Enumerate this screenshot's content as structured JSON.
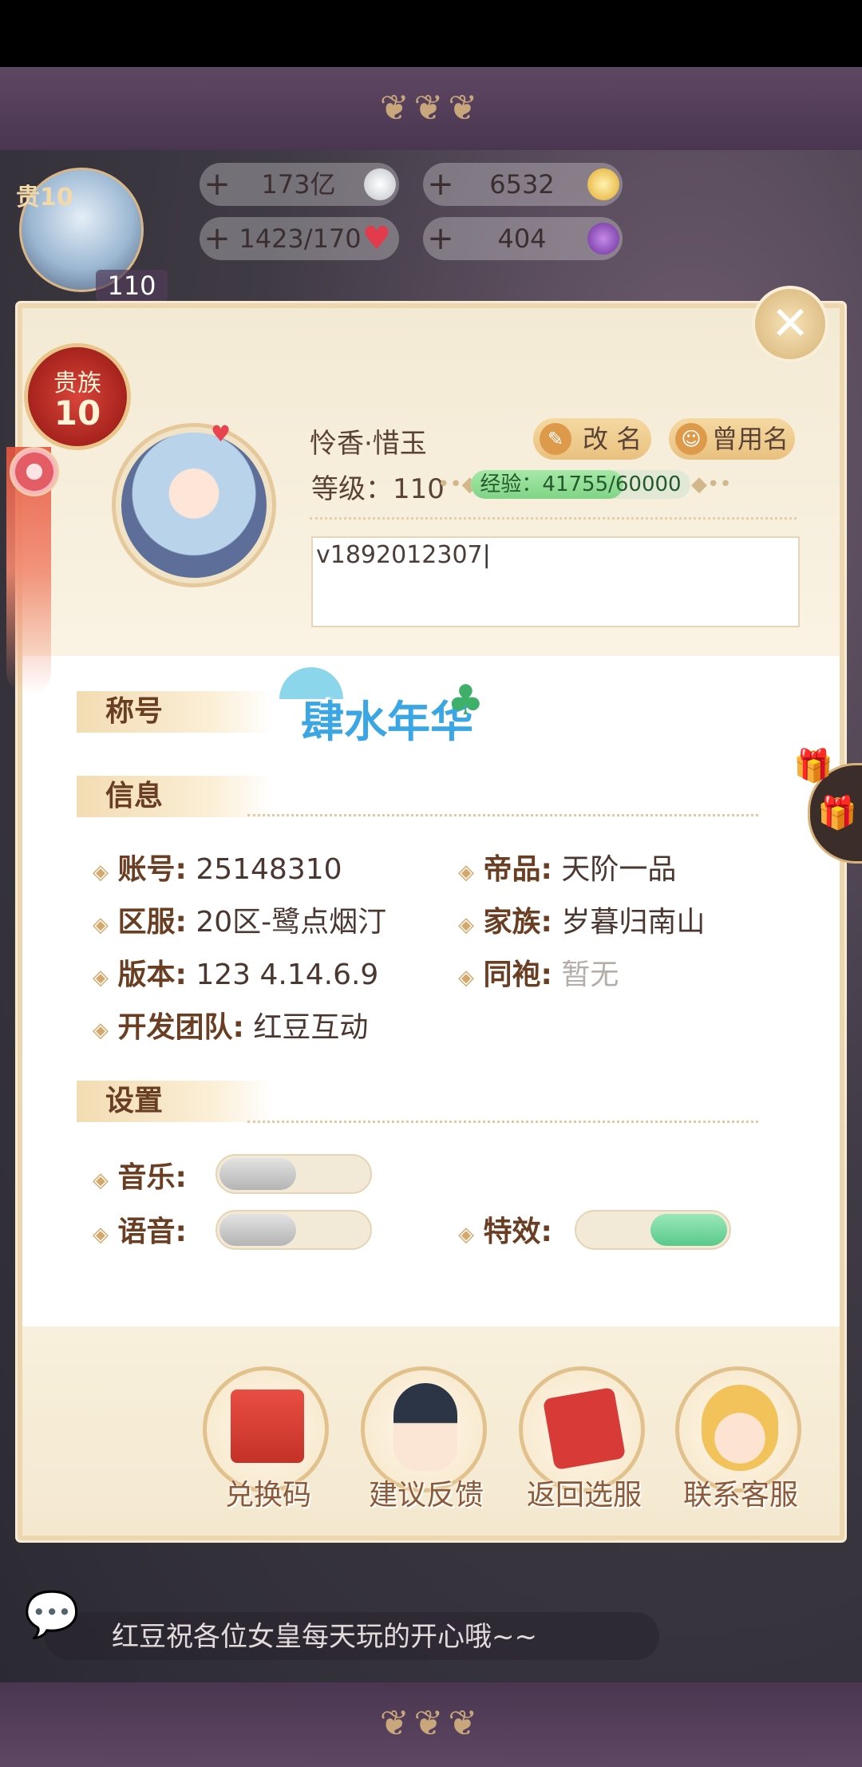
{
  "resources": {
    "silver": {
      "value": "173亿"
    },
    "gold": {
      "value": "6532"
    },
    "stamina": {
      "value": "1423/170"
    },
    "gem": {
      "value": "404"
    }
  },
  "top_avatar": {
    "badge": "贵10",
    "level": "110"
  },
  "noble_badge": {
    "label": "贵族",
    "level": "10"
  },
  "profile": {
    "name": "怜香·惜玉",
    "level_label": "等级：110",
    "exp_label": "经验：41755/60000",
    "exp_progress": 0.6959,
    "rename_label": "改 名",
    "history_name_label": "曾用名",
    "signature": "v1892012307"
  },
  "sections": {
    "title_label": "称号",
    "title_badge_text": "肆水年华",
    "info_label": "信息",
    "settings_label": "设置"
  },
  "info": {
    "account": {
      "key": "账号:",
      "value": "25148310"
    },
    "rank": {
      "key": "帝品:",
      "value": "天阶一品"
    },
    "server": {
      "key": "区服:",
      "value": "20区-鹭点烟汀"
    },
    "family": {
      "key": "家族:",
      "value": "岁暮归南山"
    },
    "version": {
      "key": "版本:",
      "value": "123 4.14.6.9"
    },
    "robe": {
      "key": "同袍:",
      "value": "暂无"
    },
    "team": {
      "key": "开发团队:",
      "value": "红豆互动"
    }
  },
  "settings": {
    "music": {
      "label": "音乐:",
      "on": false
    },
    "voice": {
      "label": "语音:",
      "on": false
    },
    "effects": {
      "label": "特效:",
      "on": true
    }
  },
  "actions": [
    {
      "label": "兑换码",
      "icon": "gift-box-icon"
    },
    {
      "label": "建议反馈",
      "icon": "feedback-character-icon"
    },
    {
      "label": "返回选服",
      "icon": "return-book-icon"
    },
    {
      "label": "联系客服",
      "icon": "customer-service-icon"
    }
  ],
  "ticker": {
    "text": "红豆祝各位女皇每天玩的开心哦~~"
  },
  "colors": {
    "accent_green": "#7fd486",
    "brand_red": "#a6231d",
    "gold": "#e0c189"
  }
}
